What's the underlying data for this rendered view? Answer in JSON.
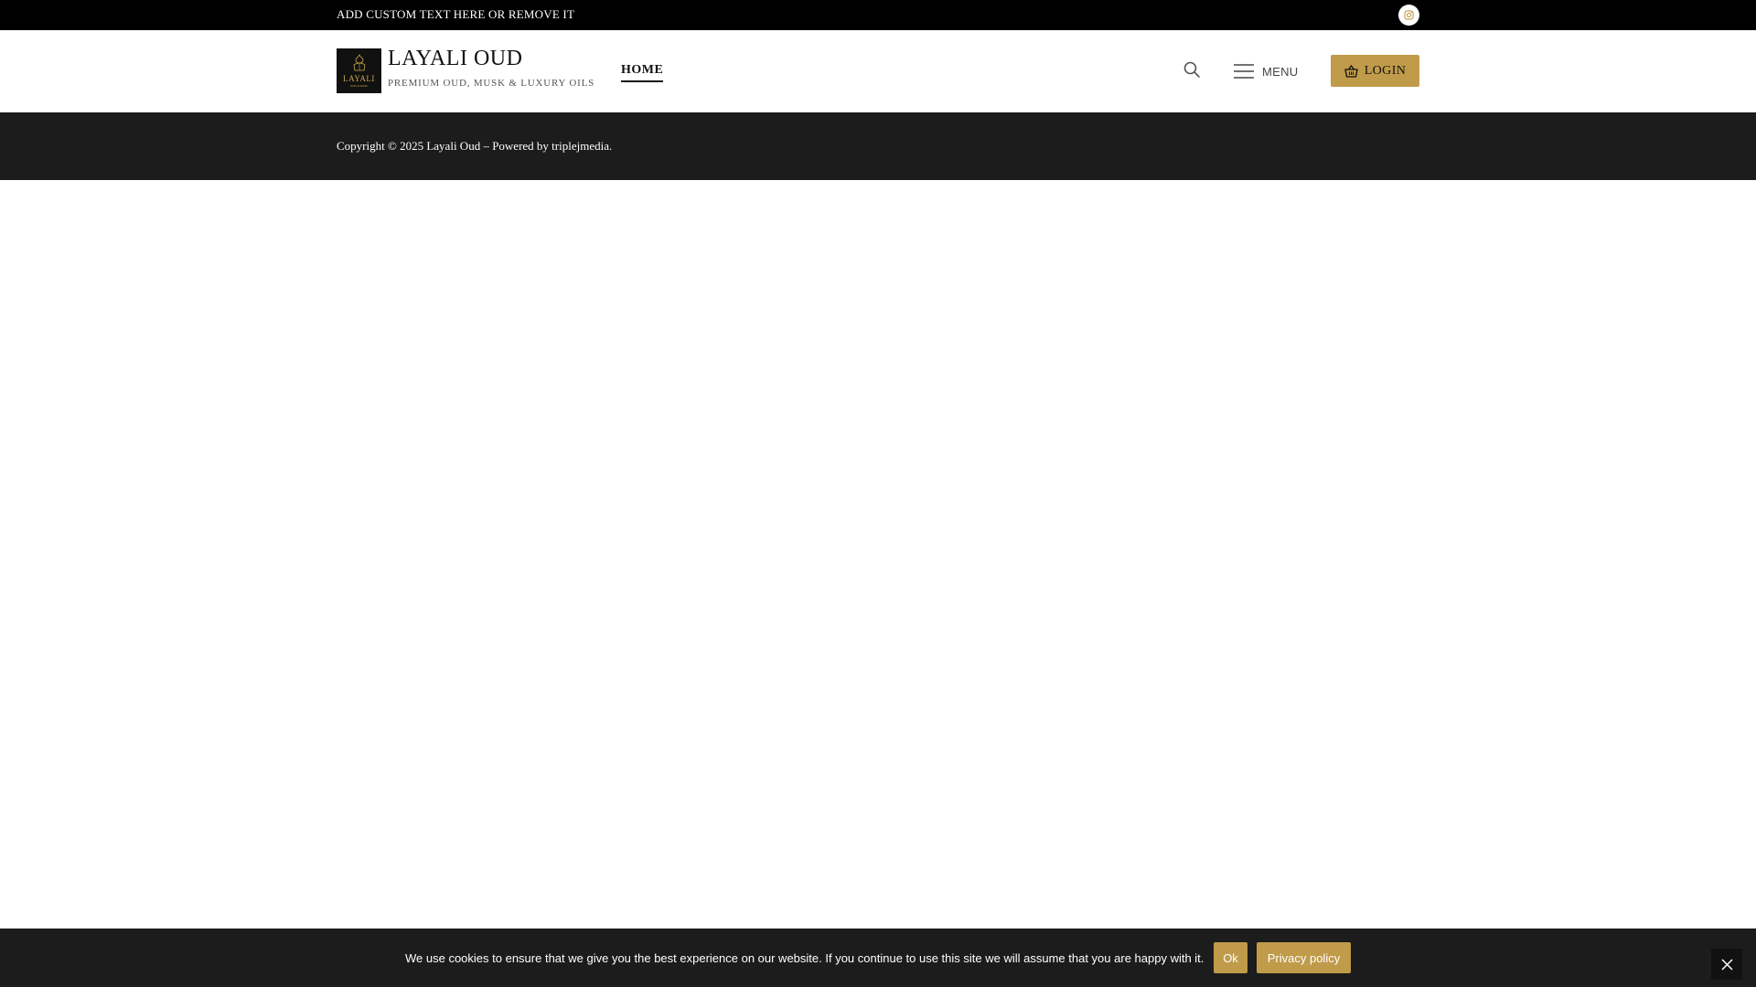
{
  "topbar": {
    "text": "ADD CUSTOM TEXT HERE OR REMOVE IT",
    "social_icon": "instagram-icon"
  },
  "header": {
    "logo_word": "LAYALI",
    "logo_sub": "OUD & MUSK",
    "site_title": "LAYALI OUD",
    "tagline": "PREMIUM OUD, MUSK & LUXURY OILS",
    "nav": [
      {
        "label": "HOME",
        "active": true
      }
    ],
    "search_icon": "search-icon",
    "menu_label": "MENU",
    "menu_icon": "hamburger-icon",
    "login_label": "LOGIN",
    "login_icon": "basket-icon"
  },
  "footer": {
    "copyright": "Copyright © 2025 Layali Oud – Powered by triplejmedia."
  },
  "cookie": {
    "message": "We use cookies to ensure that we give you the best experience on our website. If you continue to use this site we will assume that you are happy with it.",
    "ok_label": "Ok",
    "privacy_label": "Privacy policy",
    "close_icon": "close-icon"
  },
  "colors": {
    "accent": "#bf9b4a",
    "topbar_bg": "#000000",
    "footer_bg": "#1c1c1c",
    "logo_gold": "#c9a84b"
  }
}
